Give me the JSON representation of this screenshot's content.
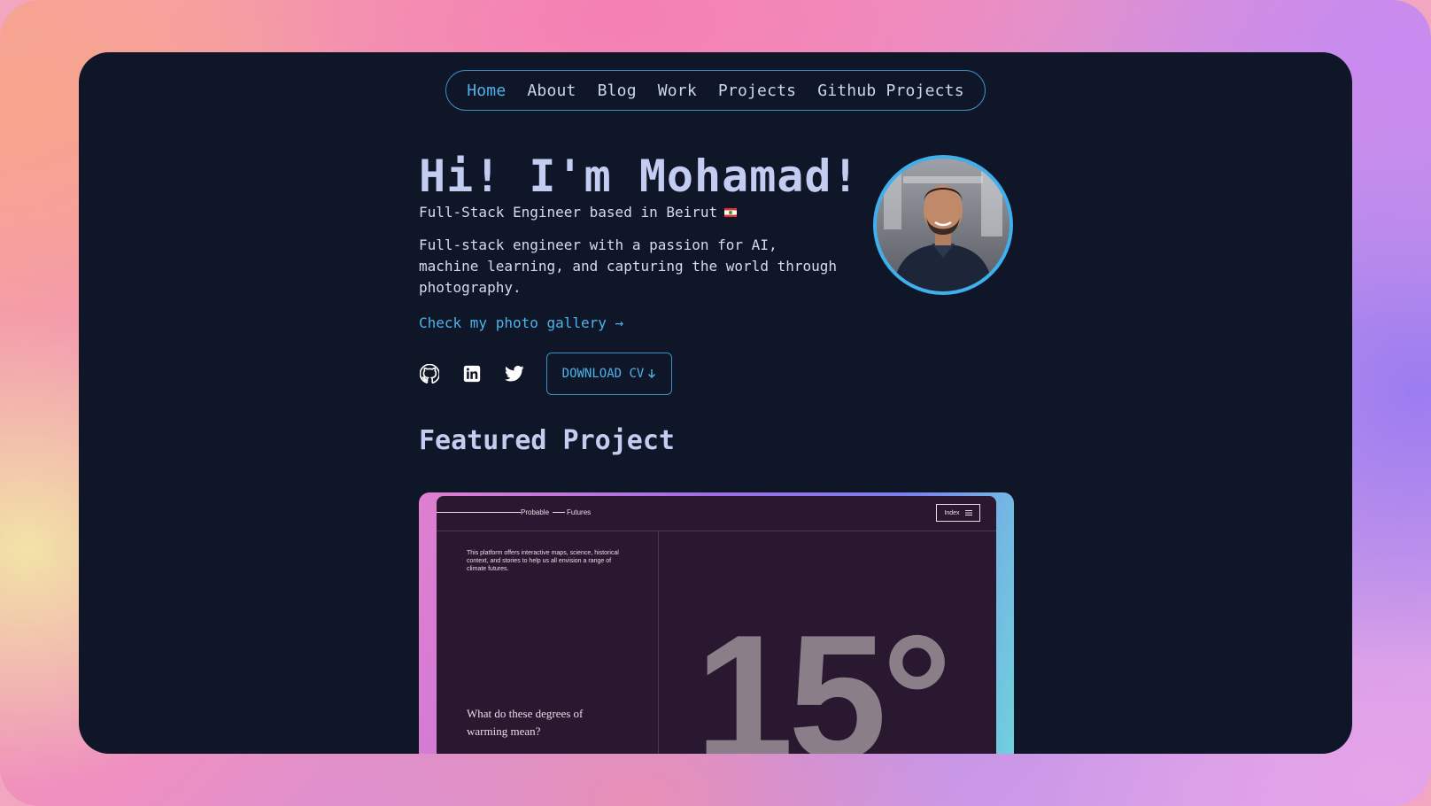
{
  "nav": {
    "items": [
      {
        "label": "Home",
        "active": true
      },
      {
        "label": "About",
        "active": false
      },
      {
        "label": "Blog",
        "active": false
      },
      {
        "label": "Work",
        "active": false
      },
      {
        "label": "Projects",
        "active": false
      },
      {
        "label": "Github Projects",
        "active": false
      }
    ]
  },
  "hero": {
    "title": "Hi! I'm Mohamad!",
    "subtitle": "Full-Stack Engineer based in Beirut",
    "flag_icon": "lebanon-flag-icon",
    "description": "Full-stack engineer with a passion for AI, machine learning, and capturing the world through photography.",
    "gallery_link": "Check my photo gallery →"
  },
  "social": {
    "icons": [
      "github-icon",
      "linkedin-icon",
      "twitter-icon"
    ]
  },
  "cv_button": {
    "label": "DOWNLOAD CV"
  },
  "featured": {
    "title": "Featured Project",
    "preview": {
      "logo_left": "Probable",
      "logo_right": "Futures",
      "index_label": "Index",
      "intro": "This platform offers interactive maps, science, historical context, and stories to help us all envision a range of climate futures.",
      "question": "What do these degrees of warming mean?",
      "big_number": "15°"
    }
  },
  "colors": {
    "window_bg": "#0e1628",
    "accent": "#4fb3ea",
    "heading": "#c3cdf2",
    "text": "#d4dbef"
  }
}
